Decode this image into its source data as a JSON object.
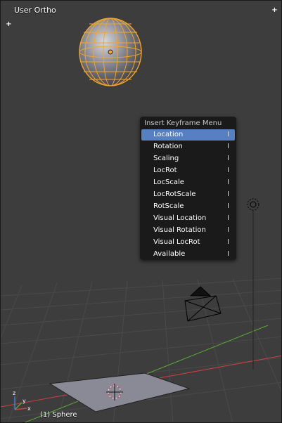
{
  "viewport": {
    "view_label": "User Ortho",
    "object_label": "(1) Sphere",
    "corner_plus": "+",
    "colors": {
      "background": "#3d3d3d",
      "selection_orange": "#f5a623",
      "x_axis": "#d04040",
      "y_axis": "#5aa837"
    }
  },
  "menu": {
    "title": "Insert Keyframe Menu",
    "items": [
      {
        "label": "Location",
        "shortcut": "I"
      },
      {
        "label": "Rotation",
        "shortcut": "I"
      },
      {
        "label": "Scaling",
        "shortcut": "I"
      },
      {
        "label": "LocRot",
        "shortcut": "I"
      },
      {
        "label": "LocScale",
        "shortcut": "I"
      },
      {
        "label": "LocRotScale",
        "shortcut": "I"
      },
      {
        "label": "RotScale",
        "shortcut": "I"
      },
      {
        "label": "Visual Location",
        "shortcut": "I"
      },
      {
        "label": "Visual Rotation",
        "shortcut": "I"
      },
      {
        "label": "Visual LocRot",
        "shortcut": "I"
      },
      {
        "label": "Available",
        "shortcut": "I"
      }
    ],
    "highlight_color": "#5680c2"
  },
  "axes_gizmo": {
    "x": "x",
    "y": "y",
    "z": "z"
  }
}
